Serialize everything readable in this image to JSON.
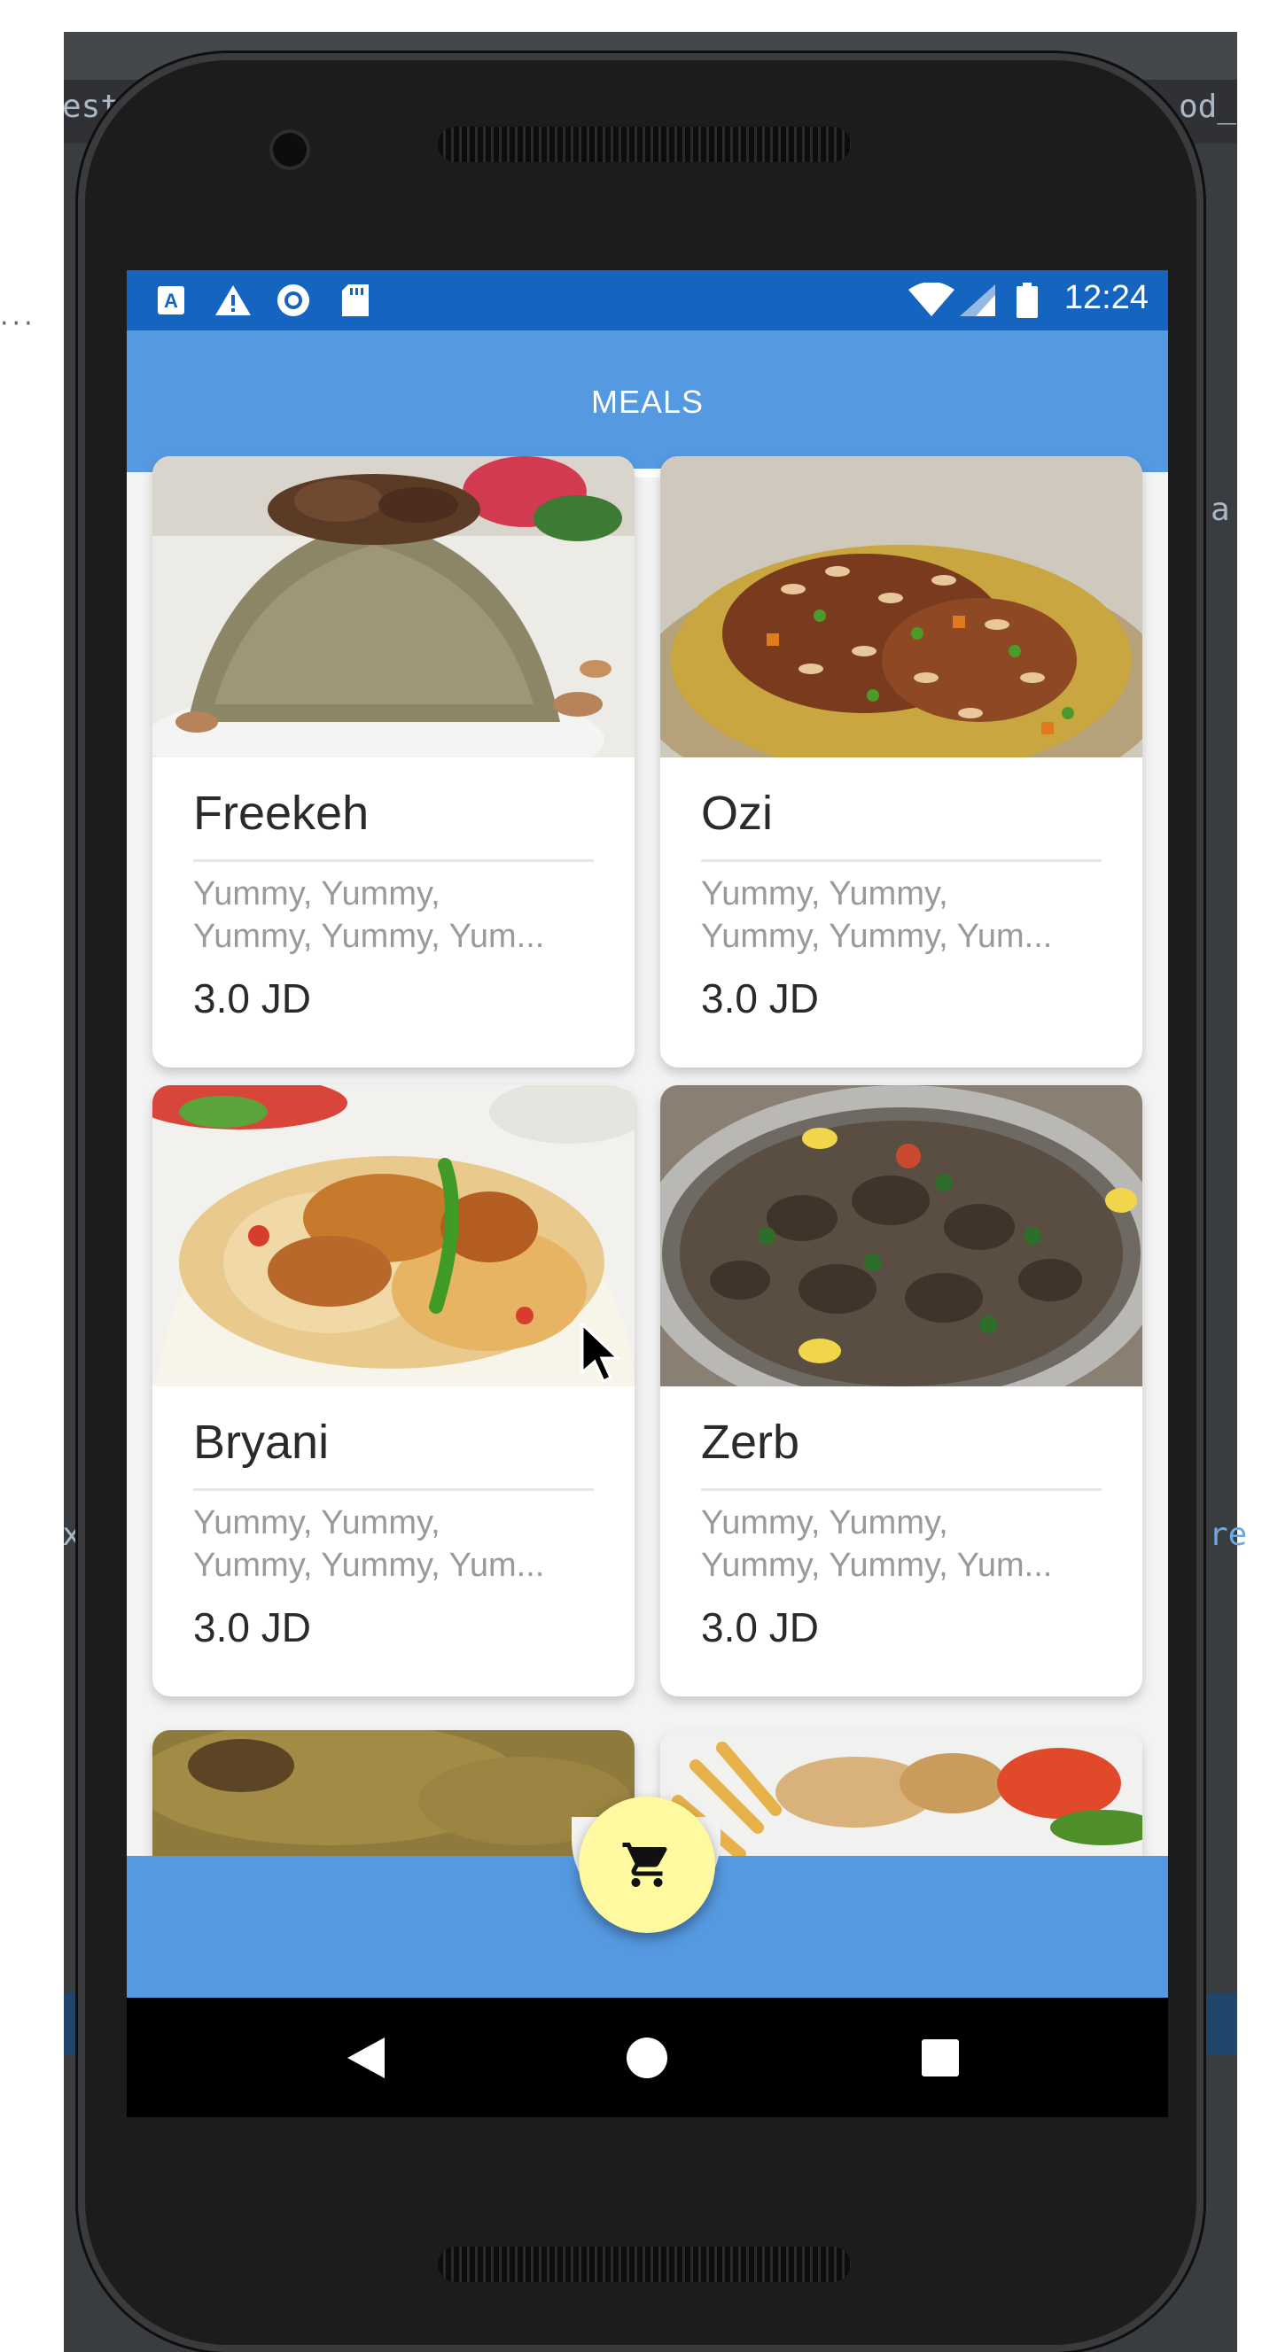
{
  "ide": {
    "left_fragment": "est",
    "right_fragment": "od_",
    "left_mid": "x",
    "right_mid": "re",
    "right_top": "a"
  },
  "status_bar": {
    "time": "12:24",
    "icons": [
      "a-box-icon",
      "warning-icon",
      "circle-icon",
      "sd-card-icon",
      "wifi-icon",
      "signal-icon",
      "battery-icon"
    ]
  },
  "app_bar": {
    "tab_label": "MEALS"
  },
  "meals": [
    {
      "name": "Freekeh",
      "desc_line1": "Yummy, Yummy,",
      "desc_line2": "Yummy, Yummy, Yum...",
      "price": "3.0 JD"
    },
    {
      "name": "Ozi",
      "desc_line1": "Yummy, Yummy,",
      "desc_line2": "Yummy, Yummy, Yum...",
      "price": "3.0 JD"
    },
    {
      "name": "Bryani",
      "desc_line1": "Yummy, Yummy,",
      "desc_line2": "Yummy, Yummy, Yum...",
      "price": "3.0 JD"
    },
    {
      "name": "Zerb",
      "desc_line1": "Yummy, Yummy,",
      "desc_line2": "Yummy, Yummy, Yum...",
      "price": "3.0 JD"
    }
  ],
  "fab": {
    "icon": "cart-icon"
  },
  "colors": {
    "status_bar": "#1565c0",
    "app_bar": "#5599e0",
    "fab": "#fff9a0",
    "nav_bar": "#000000"
  }
}
